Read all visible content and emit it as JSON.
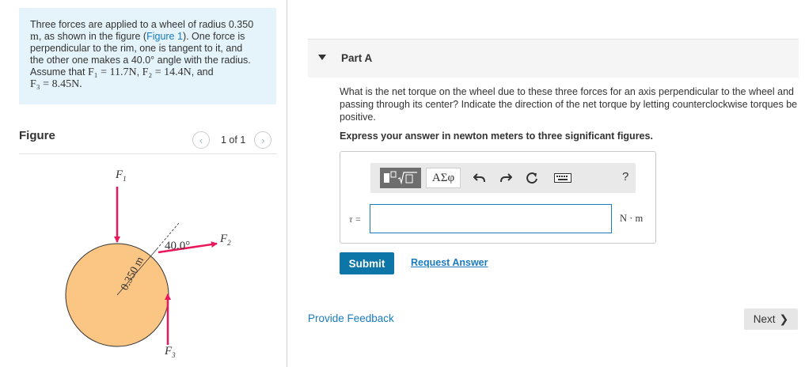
{
  "problem": {
    "line1": "Three forces are applied to a wheel of radius",
    "radius_value": "0.350",
    "line2a": ", as shown in the figure (",
    "unit_m": "m",
    "figure_link": "Figure 1",
    "line2b": "). One force is",
    "line3": "perpendicular to the rim, one is tangent to it, and",
    "line4": "the other one makes a 40.0° angle with the radius.",
    "line5a": "Assume that",
    "f1_eq": "F₁ = 11.7N",
    "f2_eq": "F₂ = 14.4N",
    "line5b": ", and",
    "f3_eq": "F₃ = 8.45N."
  },
  "figure_panel": {
    "title": "Figure",
    "pager_text": "1 of 1",
    "prev_icon": "‹",
    "next_icon": "›"
  },
  "diagram": {
    "f1_label": "F",
    "f1_sub": "1",
    "f2_label": "F",
    "f2_sub": "2",
    "f3_label": "F",
    "f3_sub": "3",
    "angle_label": "40.0°",
    "radius_label": "0.350 m",
    "wheel_color": "#fbc584",
    "arrow_color": "#e8185a"
  },
  "part": {
    "label": "Part A",
    "question": "What is the net torque on the wheel due to these three forces for an axis perpendicular to the wheel and passing through its center? Indicate the direction of the net torque by letting counterclockwise torques be positive.",
    "instruction": "Express your answer in newton meters to three significant figures."
  },
  "toolbar": {
    "greek_label": "ΑΣφ",
    "help_label": "?"
  },
  "answer": {
    "variable_label": "τ =",
    "value": "",
    "units": "N · m"
  },
  "actions": {
    "submit_label": "Submit",
    "request_label": "Request Answer",
    "feedback_label": "Provide Feedback",
    "next_label": "Next",
    "next_icon": "❯"
  },
  "colors": {
    "accent": "#1a7bbf",
    "submit_bg": "#0d76a8",
    "problem_bg": "#e4f4fa"
  }
}
